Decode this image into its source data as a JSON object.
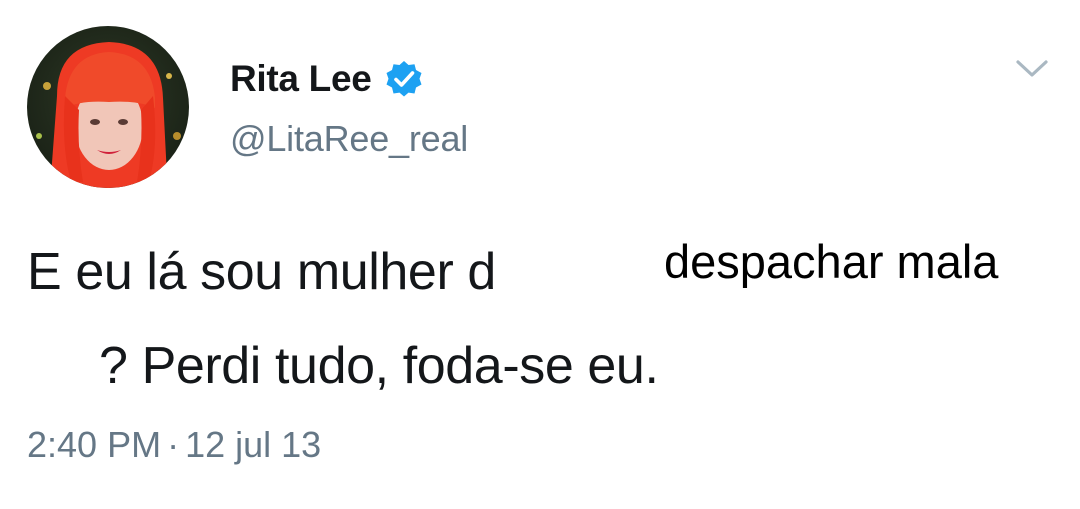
{
  "tweet": {
    "author": {
      "display_name": "Rita Lee",
      "handle": "@LitaRee_real",
      "verified": true,
      "avatar_icon": "avatar-red-hair-icon",
      "verified_color": "#1da1f2"
    },
    "body": {
      "line1": "E eu lá sou mulher d",
      "line2": "? Perdi tudo, foda-se eu.",
      "overlay_text": "despachar mala"
    },
    "meta": {
      "time": "2:40 PM",
      "separator": "·",
      "date": "12 jul 13"
    },
    "menu_icon": "chevron-down-icon"
  },
  "colors": {
    "text_primary": "#14171a",
    "text_secondary": "#657786",
    "verified_blue": "#1da1f2",
    "hair_red": "#ee3a24"
  }
}
